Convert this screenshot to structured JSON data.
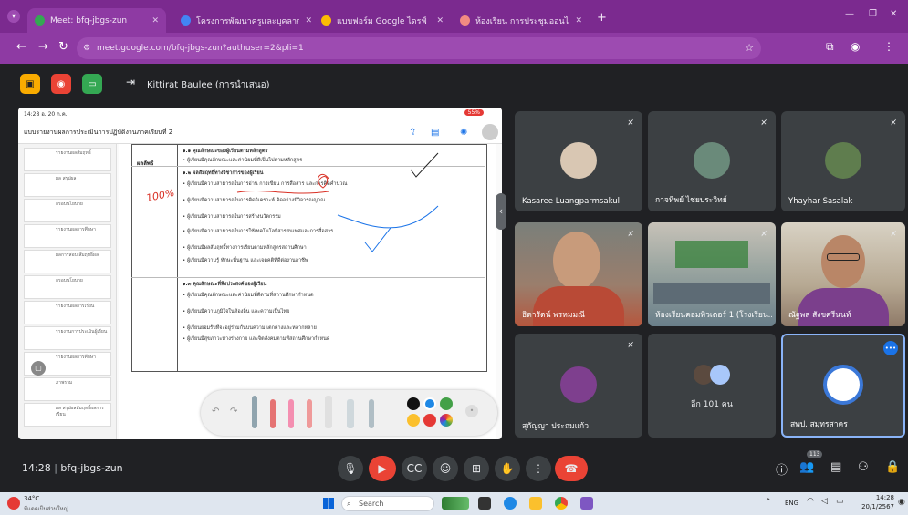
{
  "browser": {
    "tabs": [
      {
        "label": "Meet: bfq-jbgs-zun",
        "active": true
      },
      {
        "label": "โครงการพัฒนาครูและบุคลากรทางการศึกษา",
        "active": false
      },
      {
        "label": "แบบฟอร์ม Google ไดรฟ์",
        "active": false
      },
      {
        "label": "ห้องเรียน การประชุมออนไลน์",
        "active": false
      }
    ],
    "url": "meet.google.com/bfq-jbgs-zun?authuser=2&pli=1"
  },
  "meet": {
    "presenter_label": "Kittirat Baulee (การนำเสนอ)",
    "meeting_time": "14:28",
    "meeting_code": "bfq-jbgs-zun",
    "participant_count_badge": "113",
    "presented_doc": {
      "status_left": "14:28 อ. 20 ก.ค.",
      "status_right": "55%",
      "title": "แบบรายงานผลการประเมินการปฏิบัติงานภาคเรียนที่ 2",
      "thumbs": [
        "รายงานผลสัมฤทธิ์",
        "ผล สรุปผล",
        "กรอบนโยบาย",
        "รายงานผลการศึกษา",
        "ผลการสอบ สัมฤทธิ์ผล",
        "กรอบนโยบาย",
        "รายงานผลการเรียน",
        "รายงานการประเมินผู้เรียน",
        "รายงานผลการศึกษา",
        "ภาพรวม",
        "ผล สรุปผลสัมฤทธิ์ผลการเรียน"
      ],
      "heading_label": "ผลลัพธ์",
      "rows": [
        "๑.๑ คุณลักษณะของผู้เรียนตามหลักสูตร",
        "• ผู้เรียนมีคุณลักษณะและค่านิยมที่ดีเป็นไปตามหลักสูตร",
        "๑.๒ ผลสัมฤทธิ์ทางวิชาการของผู้เรียน",
        "• ผู้เรียนมีความสามารถในการอ่าน การเขียน การสื่อสาร และการคิดคำนวณ",
        "• ผู้เรียนมีความสามารถในการคิดวิเคราะห์ คิดอย่างมีวิจารณญาณ",
        "• ผู้เรียนมีความสามารถในการสร้างนวัตกรรม",
        "• ผู้เรียนมีความสามารถในการใช้เทคโนโลยีสารสนเทศและการสื่อสาร",
        "• ผู้เรียนมีผลสัมฤทธิ์ทางการเรียนตามหลักสูตรสถานศึกษา",
        "• ผู้เรียนมีความรู้ ทักษะพื้นฐาน และเจตคติที่ดีต่องานอาชีพ",
        "๑.๓ คุณลักษณะที่พึงประสงค์ของผู้เรียน",
        "• ผู้เรียนมีคุณลักษณะและค่านิยมที่ดีตามที่สถานศึกษากำหนด",
        "• ผู้เรียนมีความภูมิใจในท้องถิ่น และความเป็นไทย",
        "• ผู้เรียนยอมรับที่จะอยู่ร่วมกันบนความแตกต่างและหลากหลาย",
        "• ผู้เรียนมีสุขภาวะทางร่างกาย และจิตสังคมตามที่สถานศึกษากำหนด"
      ],
      "annotation": "100%"
    },
    "participants": [
      {
        "name": "Kasaree Luangparmsakul",
        "avatar_color": "#d9c7b3"
      },
      {
        "name": "กาจทิพย์ ไชยประวิทย์",
        "avatar_color": "#6a8a7a"
      },
      {
        "name": "Yhayhar Sasalak",
        "avatar_color": "#5f7d4e"
      },
      {
        "name": "ธิดารัตน์ พรหมมณี",
        "video": true
      },
      {
        "name": "ห้องเรียนคอมพิวเตอร์ 1 (โรงเรียน...",
        "video": true
      },
      {
        "name": "ณัฐพล สังขศรีนนท์",
        "video": true
      },
      {
        "name": "สุกัญญา ประถมแก้ว",
        "avatar_color": "#7e3f8e"
      },
      {
        "name": "อีก 101 คน",
        "avatar_color": "#a8c7fa"
      },
      {
        "name": "สพป. สมุทรสาคร",
        "avatar_color": "#3b78d8"
      }
    ]
  },
  "taskbar": {
    "weather_temp": "34°C",
    "weather_desc": "มีแดดเป็นส่วนใหญ่",
    "search_placeholder": "Search",
    "lang": "ENG",
    "clock_time": "14:28",
    "clock_date": "20/1/2567"
  },
  "colors": {
    "browser_frame": "#7b2a8f",
    "meet_background": "#202124",
    "tile_background": "#3c4043",
    "end_call_red": "#ea4335",
    "active_speaker_blue": "#8ab4f8"
  }
}
